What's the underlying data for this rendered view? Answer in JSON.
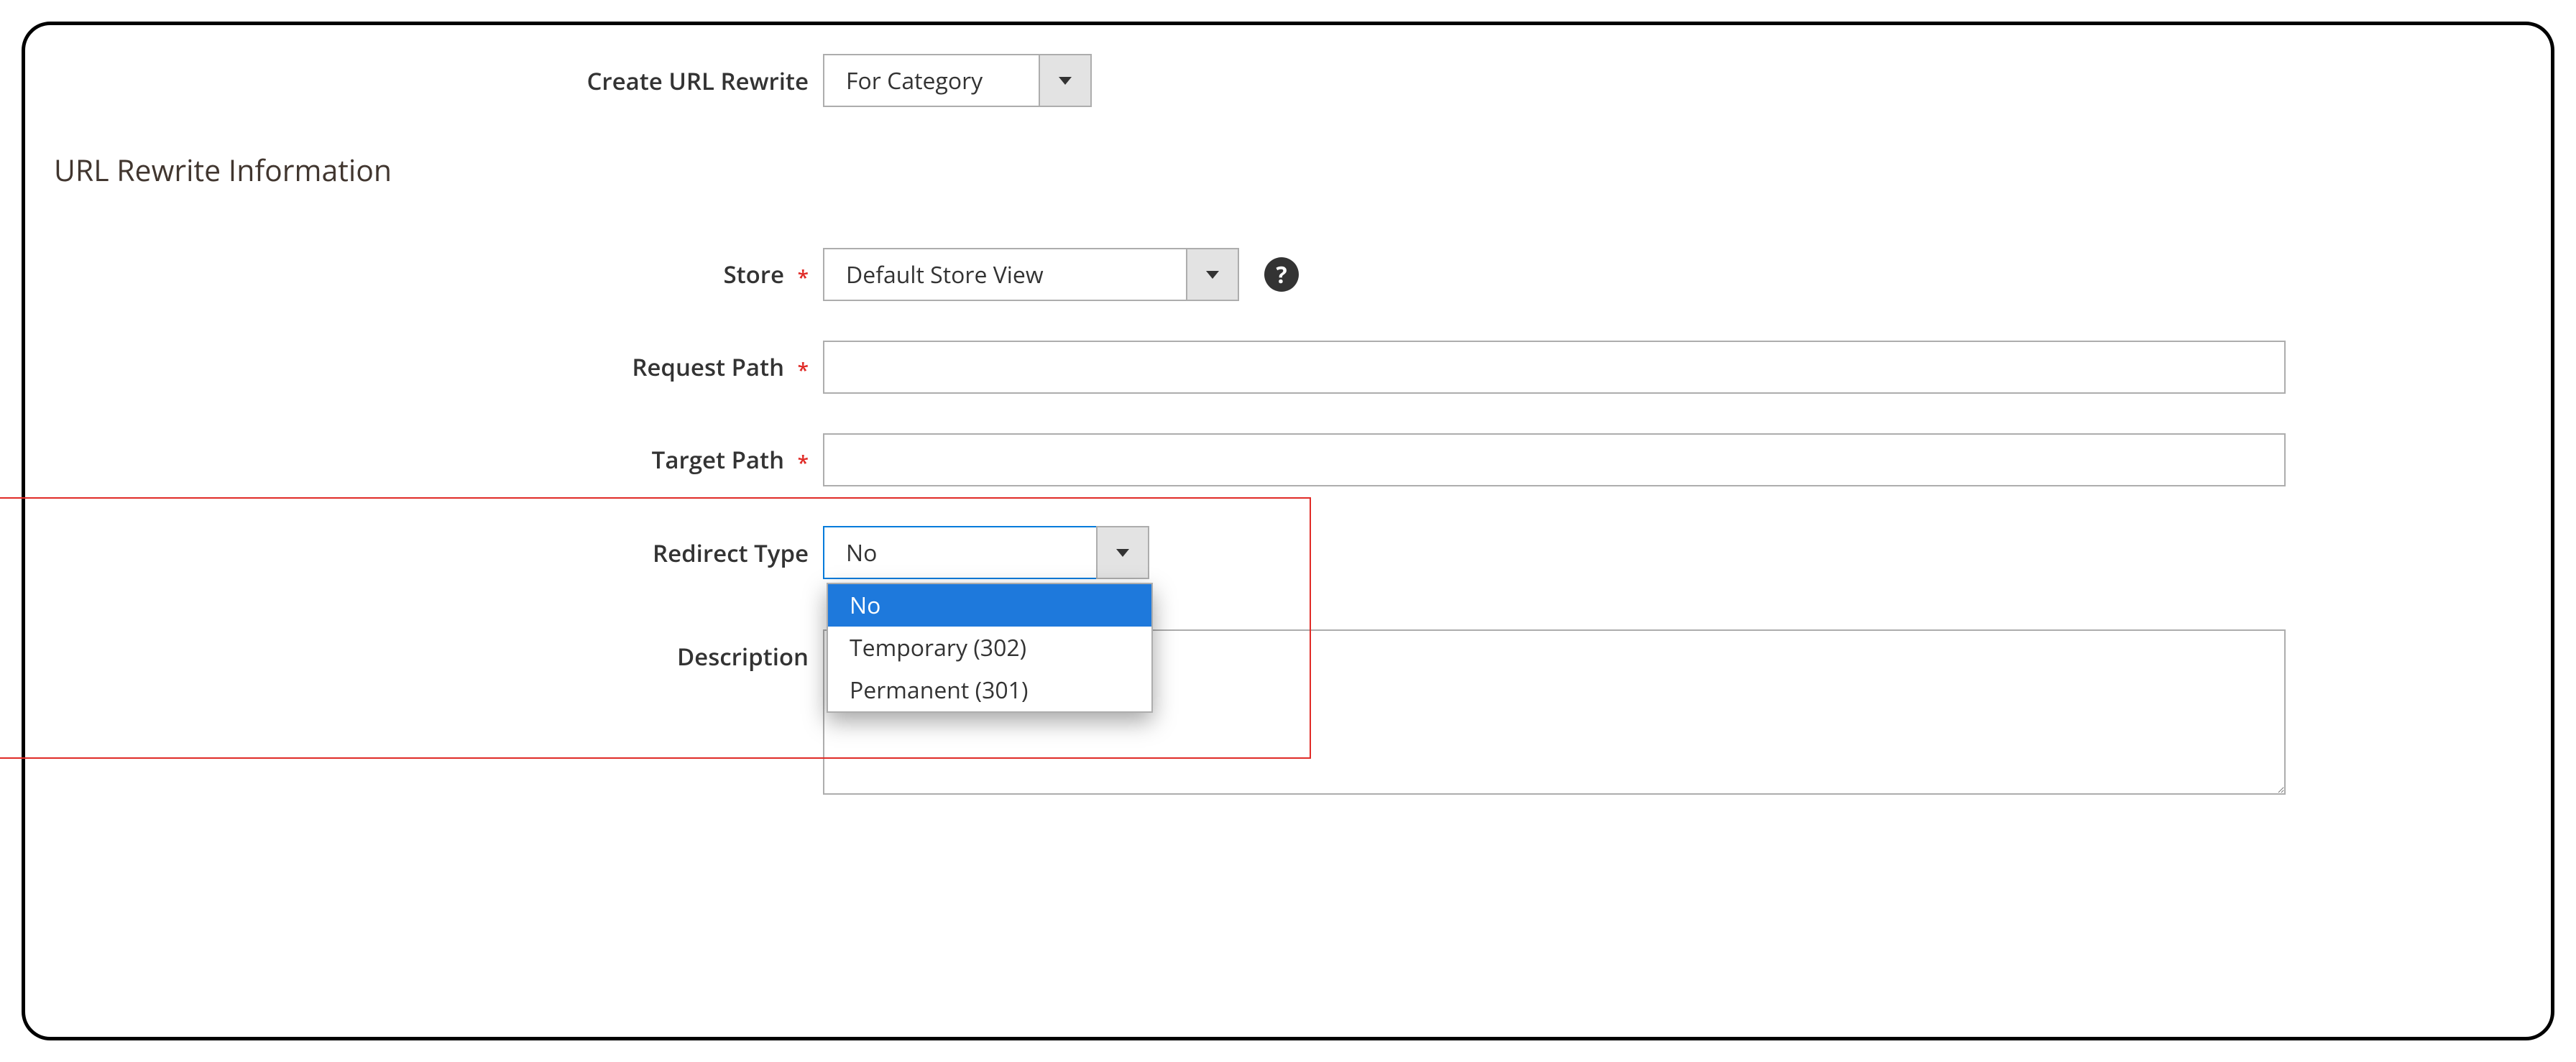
{
  "topRow": {
    "createLabel": "Create URL Rewrite",
    "createValue": "For Category"
  },
  "sectionTitle": "URL Rewrite Information",
  "form": {
    "storeLabel": "Store",
    "storeValue": "Default Store View",
    "requestPathLabel": "Request Path",
    "requestPathValue": "",
    "targetPathLabel": "Target Path",
    "targetPathValue": "",
    "redirectTypeLabel": "Redirect Type",
    "redirectTypeValue": "No",
    "redirectTypeOptions": [
      "No",
      "Temporary (302)",
      "Permanent (301)"
    ],
    "descriptionLabel": "Description",
    "descriptionValue": ""
  },
  "icons": {
    "help": "?"
  }
}
